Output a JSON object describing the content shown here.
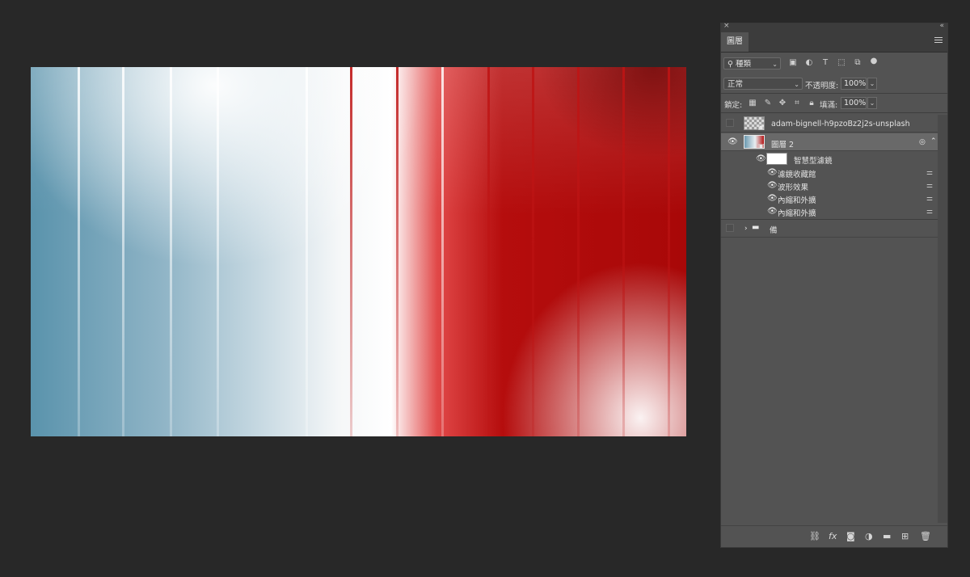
{
  "panel": {
    "close": "×",
    "collapse": "«",
    "tab_label": "圖層",
    "filter_kind": "種類",
    "blend_mode": "正常",
    "opacity_label": "不透明度:",
    "opacity_value": "100%",
    "lock_label": "鎖定:",
    "fill_label": "填滿:",
    "fill_value": "100%"
  },
  "layers": [
    {
      "name": "adam-bignell-h9pzoBz2j2s-unsplash",
      "visible": false
    },
    {
      "name": "圖層 2",
      "visible": true,
      "selected": true
    }
  ],
  "smart_filters": {
    "label": "智慧型濾鏡",
    "items": [
      "濾鏡收藏館",
      "波形效果",
      "內縮和外擴",
      "內縮和外擴"
    ]
  },
  "group": {
    "name": "備",
    "visible": false
  },
  "colors": {
    "panel_bg": "#535353",
    "app_bg": "#282828",
    "selected_row": "#696969"
  }
}
